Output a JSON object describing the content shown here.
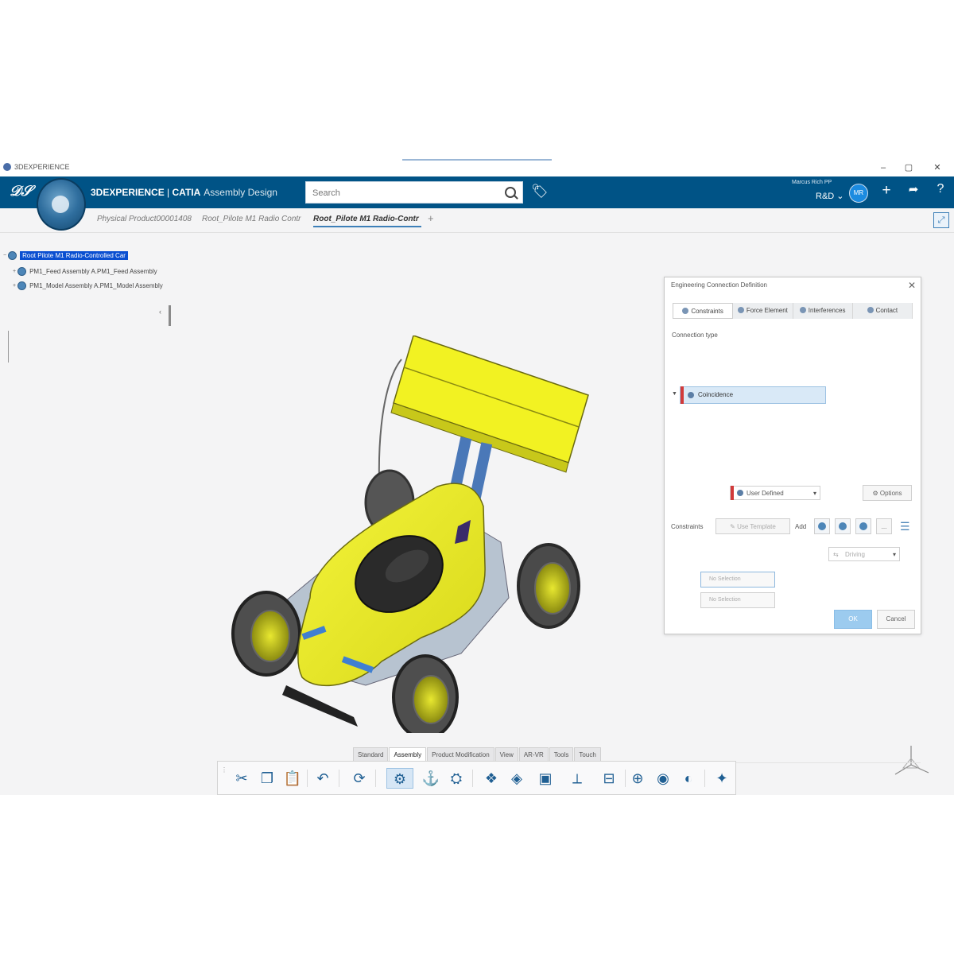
{
  "window": {
    "title": "3DEXPERIENCE",
    "minimize": "–",
    "maximize": "▢",
    "close": "✕"
  },
  "header": {
    "brand_main": "3DEXPERIENCE",
    "brand_sep": " | ",
    "brand_app": "CATIA",
    "brand_sub": "Assembly Design",
    "search_placeholder": "Search",
    "user_name": "Marcus Rich PP",
    "tenant": "R&D",
    "avatar_initials": "MR",
    "accent": "#005386"
  },
  "tabs": [
    {
      "label": "Physical Product00001408"
    },
    {
      "label": "Root_Pilote M1 Radio Contr"
    },
    {
      "label": "Root_Pilote M1 Radio-Contr"
    }
  ],
  "tab_add": "+",
  "tree": {
    "root": "Root Pilote M1 Radio-Controlled Car",
    "children": [
      "PM1_Feed Assembly A.PM1_Feed Assembly",
      "PM1_Model Assembly A.PM1_Model Assembly"
    ]
  },
  "dialog": {
    "title": "Engineering Connection Definition",
    "close": "✕",
    "tabs": [
      "Constraints",
      "Force Element",
      "Interferences",
      "Contact"
    ],
    "connection_type_label": "Connection type",
    "connection_type_value": "User Defined",
    "options_label": "Options",
    "constraints_label": "Constraints",
    "use_template_label": "Use Template",
    "add_label": "Add",
    "more_label": "...",
    "constraint_name": "Coincidence",
    "constraint_mode": "Driving",
    "selection_1": "No Selection",
    "selection_2": "No Selection",
    "ok_label": "OK",
    "cancel_label": "Cancel"
  },
  "section_tabs": [
    "Standard",
    "Assembly",
    "Product Modification",
    "View",
    "AR-VR",
    "Tools",
    "Touch"
  ],
  "active_section": "Assembly",
  "toolbar_icons": [
    "cut-icon",
    "copy-icon",
    "paste-icon",
    "undo-icon",
    "update-icon",
    "engineering-connection-icon",
    "fix-icon",
    "snap-icon",
    "explode-icon",
    "clash-icon",
    "measure-icon",
    "axis-system-icon",
    "section-icon",
    "zoom-icon",
    "view-icon",
    "render-icon",
    "compass-icon"
  ],
  "car_color": "#f2f222"
}
